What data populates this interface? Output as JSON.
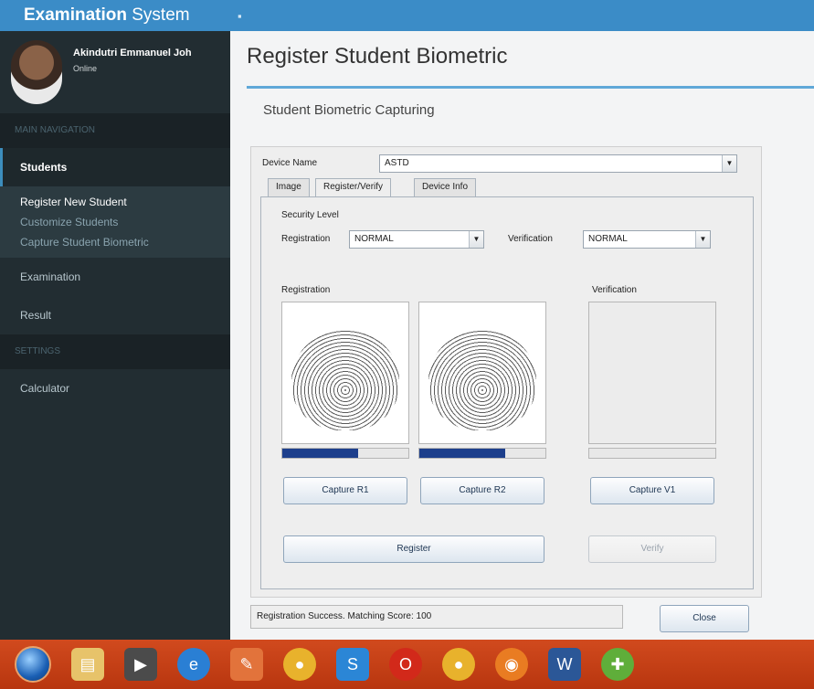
{
  "app": {
    "brand_bold": "Examination",
    "brand_light": " System",
    "menu_toggle_icon": "menu-icon"
  },
  "sidebar": {
    "user_name": "Akindutri Emmanuel Joh",
    "user_status": "Online",
    "nav_header": "MAIN NAVIGATION",
    "items": {
      "students": "Students",
      "register_new_student": "Register New Student",
      "customize_students": "Customize Students",
      "capture_student_biometric": "Capture Student Biometric",
      "examination": "Examination",
      "result": "Result",
      "settings_header": "SETTINGS",
      "calculator": "Calculator"
    }
  },
  "main": {
    "page_title": "Register Student Biometric",
    "subtitle": "Student Biometric Capturing",
    "device_label": "Device Name",
    "device_value": "ASTD",
    "tabs": [
      "Image",
      "Register/Verify",
      "Device Info"
    ],
    "active_tab": "Register/Verify",
    "security_level_label": "Security Level",
    "registration_label": "Registration",
    "registration_value": "NORMAL",
    "verification_label": "Verification",
    "verification_value": "NORMAL",
    "registration_section": "Registration",
    "verification_section": "Verification",
    "progress_r1": 0.6,
    "progress_r2": 0.68,
    "progress_v1": 0,
    "capture_r1": "Capture R1",
    "capture_r2": "Capture R2",
    "capture_v1": "Capture V1",
    "register_button": "Register",
    "verify_button": "Verify",
    "status_text": "Registration Success. Matching Score: 100",
    "close_button": "Close"
  },
  "colors": {
    "topbar": "#3b8cc7",
    "sidebar": "#222d32",
    "accent": "#60a8d8",
    "progress_fill": "#1d3f8c",
    "taskbar": "#c0401a"
  },
  "taskbar_icons": [
    "windows-start-icon",
    "file-explorer-icon",
    "media-player-icon",
    "internet-explorer-icon",
    "paint-icon",
    "chrome-icon",
    "skype-icon",
    "opera-icon",
    "chrome-icon-2",
    "firefox-icon",
    "word-icon",
    "app-icon"
  ]
}
